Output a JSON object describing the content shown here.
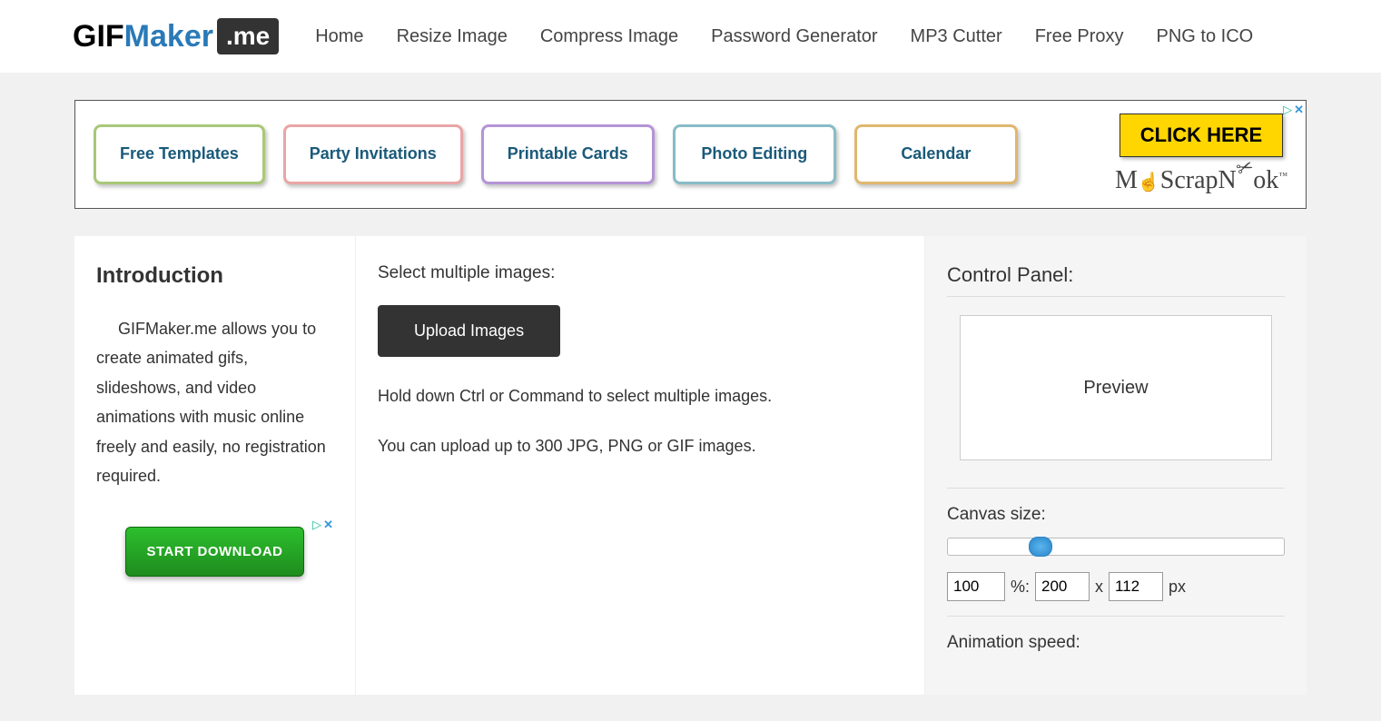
{
  "logo": {
    "gif": "GIF",
    "maker": "Maker",
    "dot": ".me"
  },
  "nav": [
    "Home",
    "Resize Image",
    "Compress Image",
    "Password Generator",
    "MP3 Cutter",
    "Free Proxy",
    "PNG to ICO"
  ],
  "ad": {
    "buttons": [
      "Free Templates",
      "Party Invitations",
      "Printable Cards",
      "Photo Editing",
      "Calendar"
    ],
    "click_here": "CLICK HERE",
    "brand_prefix": "M",
    "brand_cursor": "☝",
    "brand_suffix": "ScrapN",
    "brand_oo": "o",
    "brand_k": "k",
    "brand_tm": "™"
  },
  "intro": {
    "title": "Introduction",
    "text": "GIFMaker.me allows you to create animated gifs, slideshows, and video animations with music online freely and easily, no registration required."
  },
  "small_ad": {
    "label": "START DOWNLOAD"
  },
  "center": {
    "select_label": "Select multiple images:",
    "upload_label": "Upload Images",
    "note1": "Hold down Ctrl or Command to select multiple images.",
    "note2": "You can upload up to 300 JPG, PNG or GIF images."
  },
  "panel": {
    "title": "Control Panel:",
    "preview_label": "Preview",
    "canvas_label": "Canvas size:",
    "pct_value": "100",
    "pct_suffix": "%:",
    "w_value": "200",
    "sep": "x",
    "h_value": "112",
    "px_suffix": "px",
    "speed_label": "Animation speed:"
  },
  "adchoices": {
    "triangle": "▷",
    "x": "✕"
  }
}
